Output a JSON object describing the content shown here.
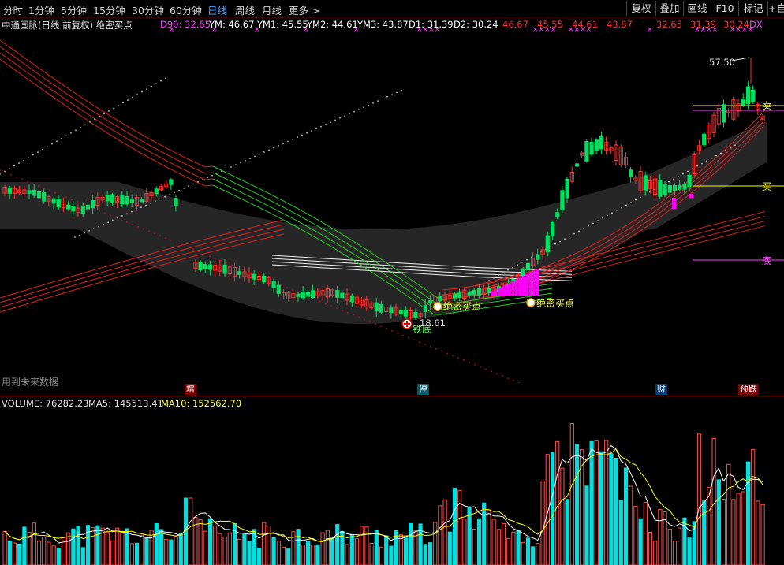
{
  "toolbar": {
    "periods": [
      "分时",
      "1分钟",
      "5分钟",
      "15分钟",
      "30分钟",
      "60分钟",
      "日线",
      "周线",
      "月线",
      "更多"
    ],
    "active_period": "日线",
    "more_arrow": ">",
    "buttons": [
      "复权",
      "叠加",
      "画线",
      "F10",
      "标记",
      "+自"
    ]
  },
  "info": {
    "title": "中通国脉(日线 前复权) 绝密买点",
    "d90": "D90: 32.65",
    "ym": "YM: 46.67",
    "ym1": "YM1: 45.55",
    "ym2": "YM2: 44.61",
    "ym3": "YM3: 43.87",
    "d1": "D1: 31.39",
    "d2": "D2: 30.24",
    "r1": "46.67",
    "r2": "45.55",
    "r3": "44.61",
    "r4": "43.87",
    "r5": "32.65",
    "r6": "31.39",
    "r7": "30.24",
    "r8": "DX",
    "star_marks": "××××"
  },
  "chart": {
    "high_label": "57.50",
    "low_label": "18.61",
    "buy_signal_1": "绝密买点",
    "buy_signal_2": "绝密买点",
    "tie_di": "铁底",
    "right_sell": "卖",
    "right_buy": "买",
    "right_bottom": "底",
    "future_data": "用到未来数据",
    "events": [
      "增",
      "停",
      "财",
      "预跌"
    ]
  },
  "volume": {
    "label": "VOLUME: 76282.23",
    "ma5": "MA5: 145513.41",
    "ma10": "MA10: 152562.70"
  },
  "colors": {
    "up": "#ff3030",
    "down": "#00e060",
    "vol_up": "#ff5050",
    "vol_down": "#00e0e0",
    "band": "#2a2a2a",
    "magenta": "#ff00ff",
    "yellow": "#ffff00"
  }
}
